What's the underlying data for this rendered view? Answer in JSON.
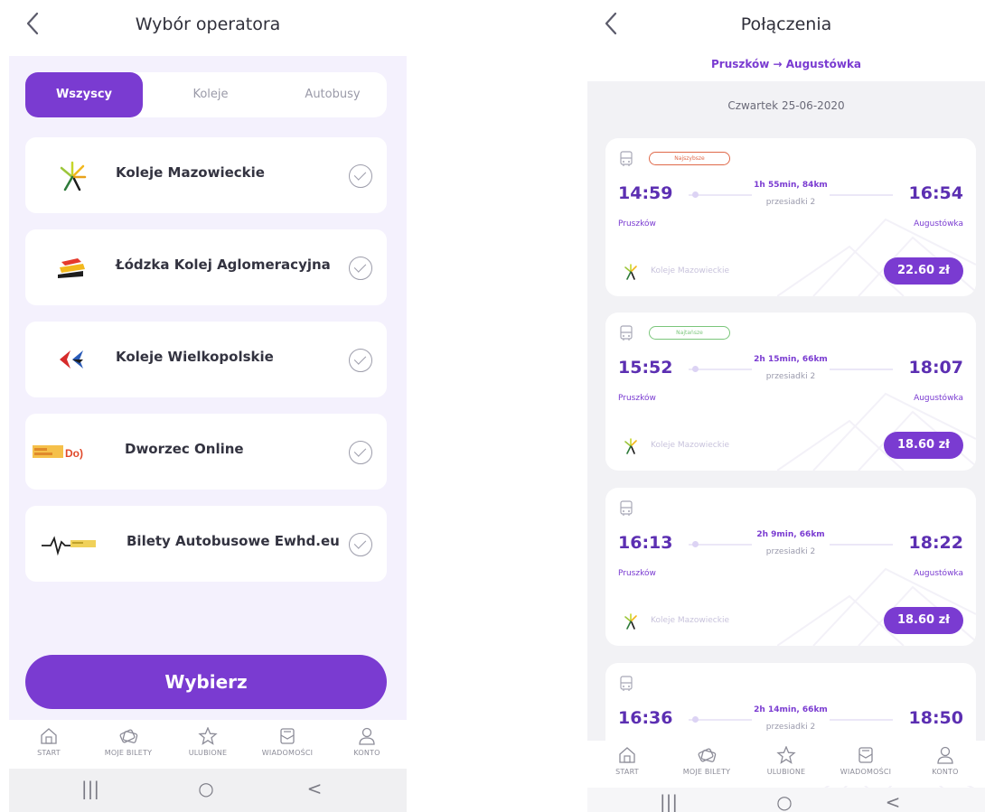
{
  "left": {
    "title": "Wybór operatora",
    "back_icon": "chevron-left-icon",
    "tabs": [
      {
        "label": "Wszyscy",
        "active": true
      },
      {
        "label": "Koleje",
        "active": false
      },
      {
        "label": "Autobusy",
        "active": false
      }
    ],
    "operators": [
      {
        "name": "Koleje Mazowieckie",
        "logo": "km-logo"
      },
      {
        "name": "Łódzka Kolej Aglomeracyjna",
        "logo": "lka-logo"
      },
      {
        "name": "Koleje Wielkopolskie",
        "logo": "kw-logo"
      },
      {
        "name": "Dworzec Online",
        "logo": "dworzec-logo",
        "logo_text": "Do)"
      },
      {
        "name": "Bilety Autobusowe Ewhd.eu",
        "logo": "ewhd-logo"
      }
    ],
    "select_button": "Wybierz"
  },
  "right": {
    "title": "Połączenia",
    "back_icon": "chevron-left-icon",
    "route": "Pruszków → Augustówka",
    "date": "Czwartek 25-06-2020",
    "connections": [
      {
        "badge": "Najszybsze",
        "badge_color": "#e0694a",
        "departure": "14:59",
        "arrival": "16:54",
        "duration": "1h 55min, 84km",
        "changes": "przesiadki 2",
        "from": "Pruszków",
        "to": "Augustówka",
        "operator": "Koleje Mazowieckie",
        "price": "22.60 zł"
      },
      {
        "badge": "Najtańsze",
        "badge_color": "#7bc67b",
        "departure": "15:52",
        "arrival": "18:07",
        "duration": "2h 15min, 66km",
        "changes": "przesiadki 2",
        "from": "Pruszków",
        "to": "Augustówka",
        "operator": "Koleje Mazowieckie",
        "price": "18.60 zł"
      },
      {
        "badge": "",
        "departure": "16:13",
        "arrival": "18:22",
        "duration": "2h 9min, 66km",
        "changes": "przesiadki 2",
        "from": "Pruszków",
        "to": "Augustówka",
        "operator": "Koleje Mazowieckie",
        "price": "18.60 zł"
      },
      {
        "badge": "",
        "departure": "16:36",
        "arrival": "18:50",
        "duration": "2h 14min, 66km",
        "changes": "przesiadki 2",
        "from": "",
        "to": "",
        "operator": "",
        "price": ""
      }
    ]
  },
  "nav": {
    "items": [
      {
        "label": "START",
        "icon": "home-icon"
      },
      {
        "label": "MOJE BILETY",
        "icon": "tickets-icon"
      },
      {
        "label": "ULUBIONE",
        "icon": "star-icon"
      },
      {
        "label": "WIADOMOŚCI",
        "icon": "message-icon"
      },
      {
        "label": "KONTO",
        "icon": "user-icon"
      }
    ]
  },
  "system_bar": {
    "recent": "|||",
    "home": "○",
    "back": "<"
  },
  "colors": {
    "accent": "#7a3bd1",
    "background_tint": "#f4f1fd",
    "badge_fastest": "#e0694a",
    "badge_cheapest": "#7bc67b"
  }
}
